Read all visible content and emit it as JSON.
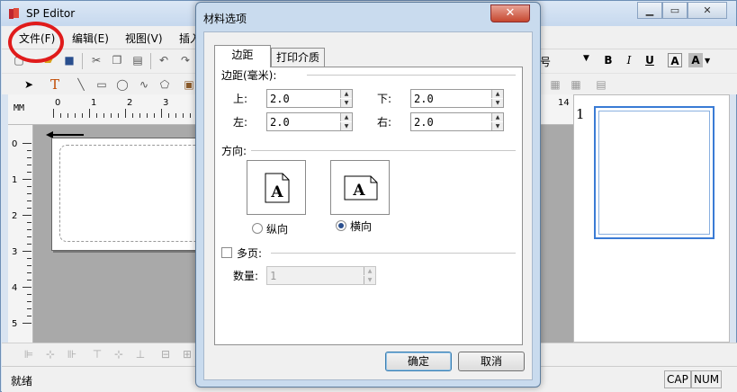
{
  "app": {
    "title": "SP Editor"
  },
  "menu": {
    "items": [
      "文件(F)",
      "编辑(E)",
      "视图(V)",
      "插入"
    ]
  },
  "toolbar": {
    "font_size_fragment": "号",
    "bold": "B",
    "italic": "I",
    "underline": "U",
    "font_color": "A",
    "highlight": "A",
    "text_tool": "T"
  },
  "ruler": {
    "unit": "MM",
    "top_ticks": [
      "0",
      "1",
      "2",
      "3"
    ],
    "top_right_tick": "14",
    "left_ticks": [
      "0",
      "1",
      "2",
      "3",
      "4",
      "5"
    ]
  },
  "preview": {
    "page_number": "1"
  },
  "status": {
    "text": "就绪",
    "caps": "CAP",
    "num": "NUM"
  },
  "dialog": {
    "title": "材料选项",
    "tabs": [
      "边距",
      "打印介质"
    ],
    "margins_group": "边距(毫米):",
    "fields": {
      "top": {
        "label": "上:",
        "value": "2.0"
      },
      "bottom": {
        "label": "下:",
        "value": "2.0"
      },
      "left": {
        "label": "左:",
        "value": "2.0"
      },
      "right": {
        "label": "右:",
        "value": "2.0"
      }
    },
    "orientation_group": "方向:",
    "portrait": "纵向",
    "landscape": "横向",
    "selected_orientation": "landscape",
    "orientation_glyph": "A",
    "multipage": "多页:",
    "count_label": "数量:",
    "count_value": "1",
    "ok": "确定",
    "cancel": "取消"
  }
}
